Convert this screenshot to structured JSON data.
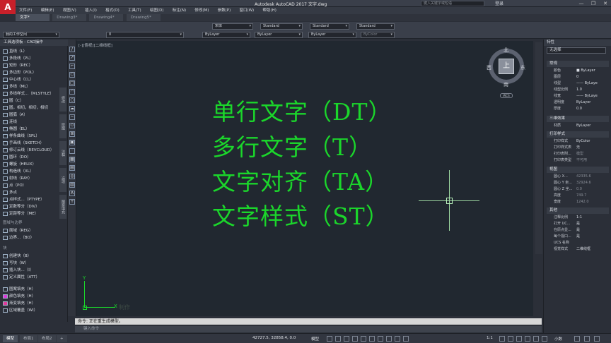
{
  "titlebar": {
    "logo": "A",
    "title": "Autodesk AutoCAD 2017    文字.dwg",
    "search_placeholder": "键入关键字或短语",
    "signin": "登录",
    "win_minimize": "—",
    "win_maximize": "❐",
    "win_close": "✕"
  },
  "menubar": {
    "items": [
      "文件(F)",
      "编辑(E)",
      "视图(V)",
      "插入(I)",
      "格式(O)",
      "工具(T)",
      "绘图(D)",
      "标注(N)",
      "修改(M)",
      "参数(P)",
      "窗口(W)",
      "帮助(H)"
    ]
  },
  "file_tabs": [
    {
      "label": "文字*",
      "active": true
    },
    {
      "label": "Drawing3*",
      "active": false
    },
    {
      "label": "Drawing4*",
      "active": false
    },
    {
      "label": "Drawing5*",
      "active": false
    }
  ],
  "toolbar": {
    "workspace": "我的工作空间",
    "layer": "0",
    "text_font": "宋体",
    "text_style": "Standard",
    "dim_style": "Standard",
    "table_style": "Standard",
    "multileader_style": "Standard",
    "color": "ByLayer",
    "linetype": "ByLayer",
    "lineweight": "ByLayer",
    "plotstyle": "ByColor"
  },
  "palette": {
    "title": "工具选项板 - CAD操作",
    "items": [
      "直线（L）",
      "多段线（PL）",
      "矩形（REC）",
      "多边形（POL）",
      "中心线（CL）",
      "多线（ML）",
      "多线样式...（MLSTYLE）",
      "圆（C）",
      "圆，相切，相切，相切",
      "圆弧（A）",
      "连线",
      "椭圆（EL）",
      "样条曲线（SPL）",
      "手画线（SKETCH）",
      "修订云线（REVCLOUD）",
      "圆环（DO）",
      "螺旋（HELIX）",
      "构造线（XL）",
      "射线（RAY）",
      "点（PO）",
      "多点",
      "点样式...（PTYPE）",
      "定数等分（DIV）",
      "定距等分（ME）"
    ],
    "section1": "图域与边界",
    "items2": [
      "面域（REG）",
      "边界...（BO）"
    ],
    "section2": "块",
    "items3": [
      "创建块（B）",
      "写块（W）",
      "插入块...（I）",
      "定义属性（ATT）"
    ],
    "items4": [
      "图案填充（H）",
      "颜色填充（H）",
      "渐变填充（H）",
      "区域覆盖（WI）"
    ],
    "side_tabs": [
      "修改",
      "绘图",
      "注释",
      "选项",
      "图案填充"
    ]
  },
  "canvas": {
    "view_label": "[-][俯视][二维线框]",
    "lines": [
      "单行文字（DT）",
      "多行文字（T）",
      "文字对齐（TA）",
      "文字样式（ST）"
    ],
    "text_color": "#1bd62b",
    "background": "#212830",
    "watermark": "制作",
    "ucs_x": "X",
    "ucs_y": "Y"
  },
  "viewcube": {
    "north": "北",
    "south": "南",
    "east": "东",
    "west": "西",
    "face": "上",
    "wcs": "WCS"
  },
  "command": {
    "history": "命令: 正在重生成模型。",
    "prompt": "键入命令"
  },
  "properties": {
    "title": "特性",
    "selection": "无选择",
    "sections": {
      "general": "常规",
      "3d": "三维效果",
      "plot": "打印样式",
      "view": "视图",
      "misc": "其他"
    },
    "general_rows": [
      {
        "k": "颜色",
        "v": "■ ByLayer"
      },
      {
        "k": "图层",
        "v": "0"
      },
      {
        "k": "线型",
        "v": "—— ByLaye"
      },
      {
        "k": "线型比例",
        "v": "1.0"
      },
      {
        "k": "线宽",
        "v": "—— ByLaye"
      },
      {
        "k": "透明度",
        "v": "ByLayer"
      },
      {
        "k": "厚度",
        "v": "0.0"
      }
    ],
    "3d_rows": [
      {
        "k": "材质",
        "v": "ByLayer"
      }
    ],
    "plot_rows": [
      {
        "k": "打印样式",
        "v": "ByColor"
      },
      {
        "k": "打印样式表",
        "v": "无"
      },
      {
        "k": "打印表附...",
        "v": "模型"
      },
      {
        "k": "打印表类型",
        "v": "不可用"
      }
    ],
    "view_rows": [
      {
        "k": "圆心 X...",
        "v": "42335.6"
      },
      {
        "k": "圆心 Y 坐...",
        "v": "32924.6"
      },
      {
        "k": "圆心 Z 坐...",
        "v": "0.0"
      },
      {
        "k": "高度",
        "v": "749.7"
      },
      {
        "k": "宽度",
        "v": "1242.0"
      }
    ],
    "misc_rows": [
      {
        "k": "注释比例",
        "v": "1:1"
      },
      {
        "k": "打开 UC...",
        "v": "是"
      },
      {
        "k": "在原点显...",
        "v": "是"
      },
      {
        "k": "每个视口...",
        "v": "是"
      },
      {
        "k": "UCS 名称",
        "v": ""
      },
      {
        "k": "视觉样式",
        "v": "二维线框"
      }
    ]
  },
  "statusbar": {
    "layout_tabs": [
      {
        "label": "模型",
        "active": true
      },
      {
        "label": "布局1",
        "active": false
      },
      {
        "label": "布局2",
        "active": false
      }
    ],
    "add_tab": "+",
    "coords": "42727.5, 32858.4, 0.0",
    "model_label": "模型",
    "scale": "1:1",
    "zoom_label": "小数"
  }
}
